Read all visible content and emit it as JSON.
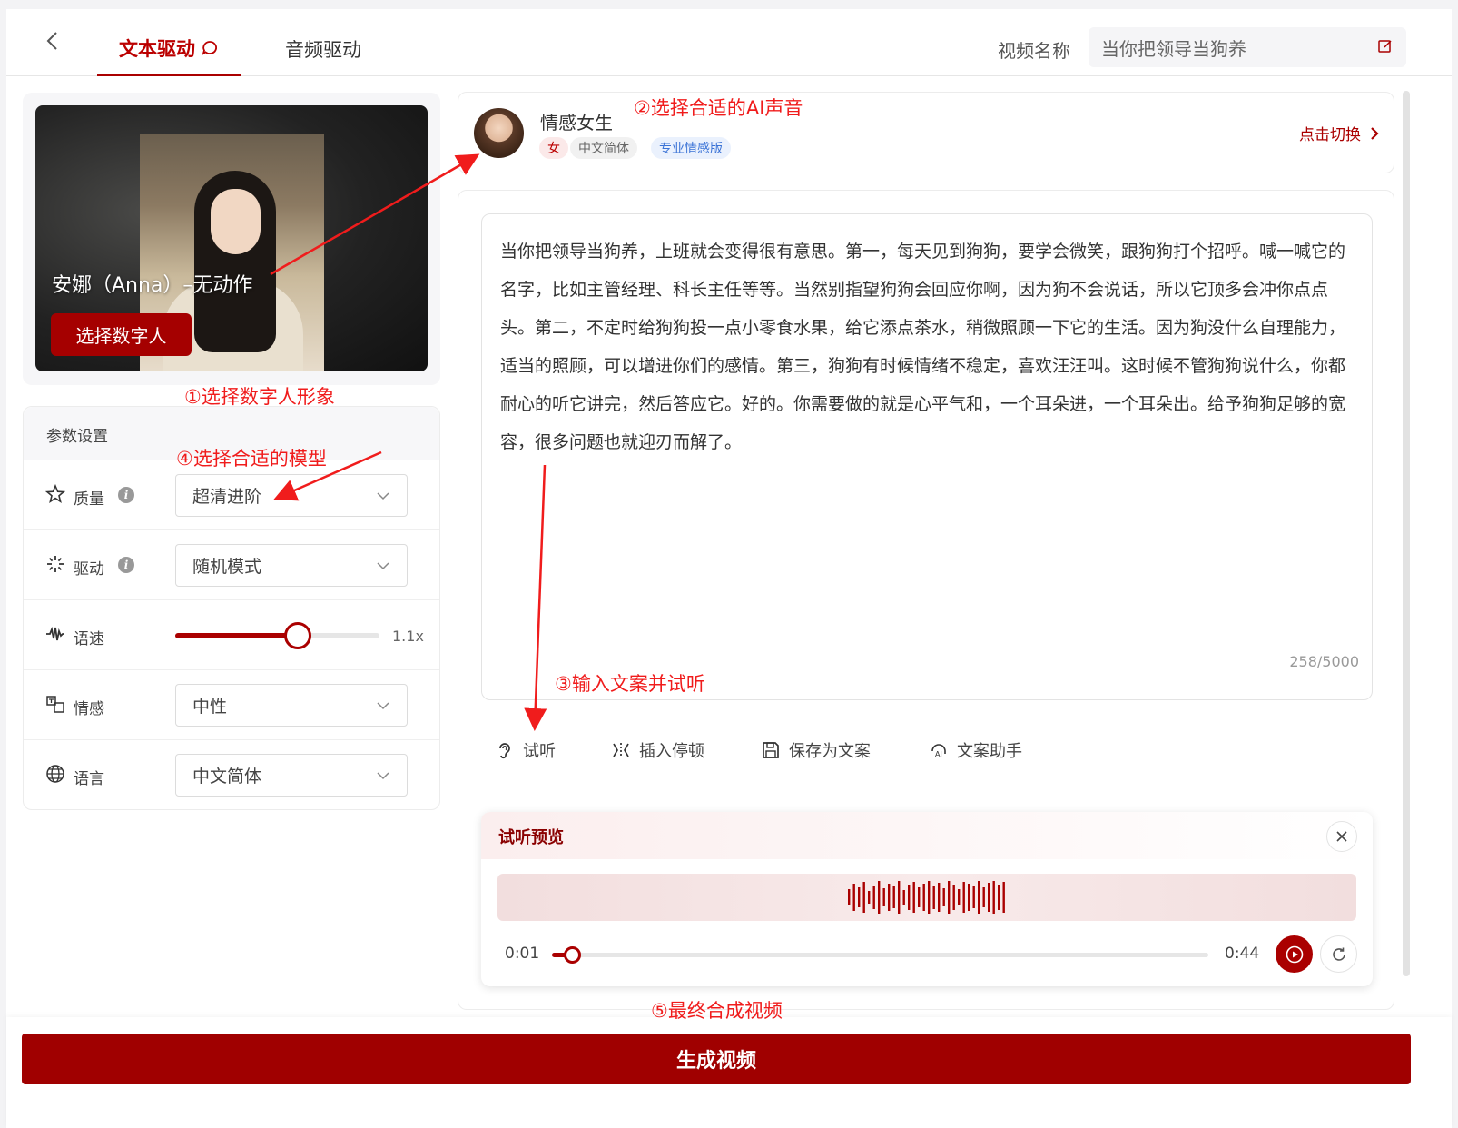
{
  "header": {
    "tabs": [
      {
        "label": "文本驱动",
        "active": true
      },
      {
        "label": "音频驱动",
        "active": false
      }
    ],
    "video_name_label": "视频名称",
    "video_name_value": "当你把领导当狗养"
  },
  "avatar": {
    "name": "安娜（Anna）–无动作",
    "select_button": "选择数字人"
  },
  "params": {
    "title": "参数设置",
    "quality": {
      "label": "质量",
      "value": "超清进阶"
    },
    "drive": {
      "label": "驱动",
      "value": "随机模式"
    },
    "speed": {
      "label": "语速",
      "value": "1.1x",
      "level": 0.6
    },
    "emotion": {
      "label": "情感",
      "value": "中性"
    },
    "language": {
      "label": "语言",
      "value": "中文简体"
    }
  },
  "voice": {
    "name": "情感女生",
    "tags": [
      "女",
      "中文简体",
      "专业情感版"
    ],
    "switch_label": "点击切换"
  },
  "editor": {
    "text": "当你把领导当狗养，上班就会变得很有意思。第一，每天见到狗狗，要学会微笑，跟狗狗打个招呼。喊一喊它的名字，比如主管经理、科长主任等等。当然别指望狗狗会回应你啊，因为狗不会说话，所以它顶多会冲你点点头。第二，不定时给狗狗投一点小零食水果，给它添点茶水，稍微照顾一下它的生活。因为狗没什么自理能力，适当的照顾，可以增进你们的感情。第三，狗狗有时候情绪不稳定，喜欢汪汪叫。这时候不管狗狗说什么，你都耐心的听它讲完，然后答应它。好的。你需要做的就是心平气和，一个耳朵进，一个耳朵出。给予狗狗足够的宽容，很多问题也就迎刃而解了。",
    "char_count": "258/5000",
    "tools": [
      "试听",
      "插入停顿",
      "保存为文案",
      "文案助手"
    ]
  },
  "preview": {
    "title": "试听预览",
    "time_current": "0:01",
    "time_total": "0:44",
    "progress": 0.03
  },
  "footer": {
    "generate_button": "生成视频"
  },
  "annotations": {
    "step1": "①选择数字人形象",
    "step2": "②选择合适的AI声音",
    "step3": "③输入文案并试听",
    "step4": "④选择合适的模型",
    "step5": "⑤最终合成视频",
    "color": "#f01c1c"
  },
  "colors": {
    "accent": "#a00000"
  }
}
